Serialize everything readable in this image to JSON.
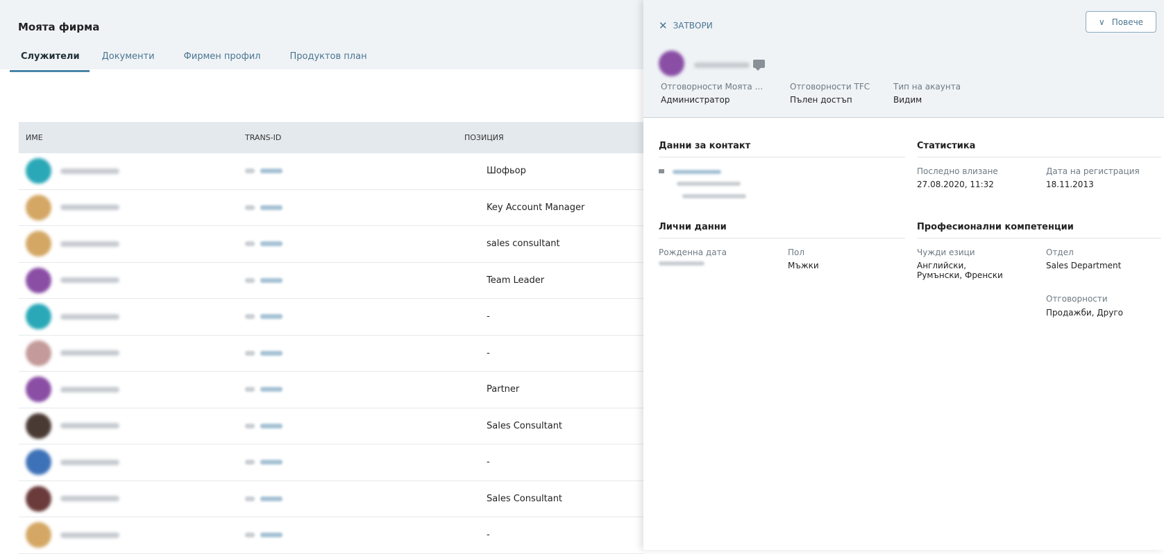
{
  "page": {
    "title": "Моята фирма",
    "tabs": [
      {
        "label": "Служители",
        "active": true
      },
      {
        "label": "Документи",
        "active": false
      },
      {
        "label": "Фирмен профил",
        "active": false
      },
      {
        "label": "Продуктов план",
        "active": false
      }
    ]
  },
  "table": {
    "headers": {
      "name": "ИМЕ",
      "trans_id": "TRANS-ID",
      "position": "ПОЗИЦИЯ"
    },
    "rows": [
      {
        "avatar_color": "#2aa8b8",
        "position": "Шофьор"
      },
      {
        "avatar_color": "#d4a764",
        "position": "Key Account Manager"
      },
      {
        "avatar_color": "#d4a764",
        "position": "sales consultant"
      },
      {
        "avatar_color": "#8a4ea5",
        "position": "Team Leader"
      },
      {
        "avatar_color": "#2aa8b8",
        "position": "-"
      },
      {
        "avatar_color": "#c49a9a",
        "position": "-"
      },
      {
        "avatar_color": "#8a4ea5",
        "position": "Partner"
      },
      {
        "avatar_color": "#4a3a34",
        "position": "Sales Consultant"
      },
      {
        "avatar_color": "#3e72b8",
        "position": "-"
      },
      {
        "avatar_color": "#6b3b3b",
        "position": "Sales Consultant"
      },
      {
        "avatar_color": "#d4a764",
        "position": "-"
      }
    ]
  },
  "panel": {
    "close_label": "ЗАТВОРИ",
    "more_label": "Повече",
    "avatar_color": "#8a4ea5",
    "header_fields": [
      {
        "label": "Отговорности Моята ...",
        "value": "Администратор"
      },
      {
        "label": "Отговорности TFC",
        "value": "Пълен достъп"
      },
      {
        "label": "Тип на акаунта",
        "value": "Видим"
      }
    ],
    "contact": {
      "title": "Данни за контакт"
    },
    "statistics": {
      "title": "Статистика",
      "last_login_label": "Последно влизане",
      "last_login_value": "27.08.2020, 11:32",
      "reg_date_label": "Дата на регистрация",
      "reg_date_value": "18.11.2013"
    },
    "personal": {
      "title": "Лични данни",
      "birth_label": "Рожденна дата",
      "gender_label": "Пол",
      "gender_value": "Мъжки"
    },
    "professional": {
      "title": "Професионални компетенции",
      "languages_label": "Чужди езици",
      "languages_value": "Английски, Румънски, Френски",
      "department_label": "Отдел",
      "department_value": "Sales Department",
      "responsibilities_label": "Отговорности",
      "responsibilities_value": "Продажби, Друго"
    }
  }
}
